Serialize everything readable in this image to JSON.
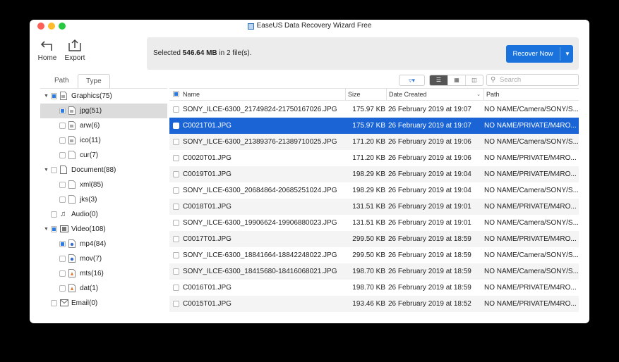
{
  "window": {
    "title": "EaseUS Data Recovery Wizard Free"
  },
  "toolbar": {
    "home_label": "Home",
    "export_label": "Export"
  },
  "status": {
    "prefix": "Selected ",
    "size": "546.64 MB",
    "suffix": " in 2 file(s)."
  },
  "recover_button": {
    "label": "Recover Now"
  },
  "tabs": {
    "path": "Path",
    "type": "Type"
  },
  "search": {
    "placeholder": "Search"
  },
  "sidebar": {
    "items": [
      {
        "label": "Graphics(75)"
      },
      {
        "label": "jpg(51)"
      },
      {
        "label": "arw(6)"
      },
      {
        "label": "ico(11)"
      },
      {
        "label": "cur(7)"
      },
      {
        "label": "Document(88)"
      },
      {
        "label": "xml(85)"
      },
      {
        "label": "jks(3)"
      },
      {
        "label": "Audio(0)"
      },
      {
        "label": "Video(108)"
      },
      {
        "label": "mp4(84)"
      },
      {
        "label": "mov(7)"
      },
      {
        "label": "mts(16)"
      },
      {
        "label": "dat(1)"
      },
      {
        "label": "Email(0)"
      }
    ]
  },
  "table": {
    "columns": {
      "name": "Name",
      "size": "Size",
      "date": "Date Created",
      "path": "Path"
    },
    "rows": [
      {
        "name": "SONY_ILCE-6300_21749824-21750167026.JPG",
        "size": "175.97 KB",
        "date": "26 February 2019 at 19:07",
        "path": "NO NAME/Camera/SONY/S..."
      },
      {
        "name": "C0021T01.JPG",
        "size": "175.97 KB",
        "date": "26 February 2019 at 19:07",
        "path": "NO NAME/PRIVATE/M4RO..."
      },
      {
        "name": "SONY_ILCE-6300_21389376-21389710025.JPG",
        "size": "171.20 KB",
        "date": "26 February 2019 at 19:06",
        "path": "NO NAME/Camera/SONY/S..."
      },
      {
        "name": "C0020T01.JPG",
        "size": "171.20 KB",
        "date": "26 February 2019 at 19:06",
        "path": "NO NAME/PRIVATE/M4RO..."
      },
      {
        "name": "C0019T01.JPG",
        "size": "198.29 KB",
        "date": "26 February 2019 at 19:04",
        "path": "NO NAME/PRIVATE/M4RO..."
      },
      {
        "name": "SONY_ILCE-6300_20684864-20685251024.JPG",
        "size": "198.29 KB",
        "date": "26 February 2019 at 19:04",
        "path": "NO NAME/Camera/SONY/S..."
      },
      {
        "name": "C0018T01.JPG",
        "size": "131.51 KB",
        "date": "26 February 2019 at 19:01",
        "path": "NO NAME/PRIVATE/M4RO..."
      },
      {
        "name": "SONY_ILCE-6300_19906624-19906880023.JPG",
        "size": "131.51 KB",
        "date": "26 February 2019 at 19:01",
        "path": "NO NAME/Camera/SONY/S..."
      },
      {
        "name": "C0017T01.JPG",
        "size": "299.50 KB",
        "date": "26 February 2019 at 18:59",
        "path": "NO NAME/PRIVATE/M4RO..."
      },
      {
        "name": "SONY_ILCE-6300_18841664-18842248022.JPG",
        "size": "299.50 KB",
        "date": "26 February 2019 at 18:59",
        "path": "NO NAME/Camera/SONY/S..."
      },
      {
        "name": "SONY_ILCE-6300_18415680-18416068021.JPG",
        "size": "198.70 KB",
        "date": "26 February 2019 at 18:59",
        "path": "NO NAME/Camera/SONY/S..."
      },
      {
        "name": "C0016T01.JPG",
        "size": "198.70 KB",
        "date": "26 February 2019 at 18:59",
        "path": "NO NAME/PRIVATE/M4RO..."
      },
      {
        "name": "C0015T01.JPG",
        "size": "193.46 KB",
        "date": "26 February 2019 at 18:52",
        "path": "NO NAME/PRIVATE/M4RO..."
      }
    ]
  },
  "colors": {
    "accent": "#1a73dc",
    "selection": "#1a64d6",
    "checkbox": "#2c7be5"
  },
  "icons": {
    "home": "back-arrow-icon",
    "export": "export-icon",
    "filter": "filter-icon",
    "search": "search-icon"
  }
}
